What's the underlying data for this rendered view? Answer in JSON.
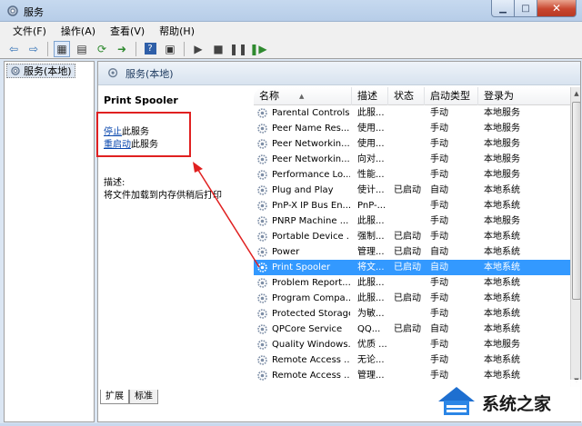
{
  "window": {
    "title": "服务"
  },
  "menu": [
    "文件(F)",
    "操作(A)",
    "查看(V)",
    "帮助(H)"
  ],
  "tree": {
    "root_label": "服务(本地)"
  },
  "pane_header": "服务(本地)",
  "detail": {
    "service_name": "Print Spooler",
    "stop_link": "停止",
    "stop_suffix": "此服务",
    "restart_link": "重启动",
    "restart_suffix": "此服务",
    "desc_label": "描述:",
    "desc_text": "将文件加载到内存供稍后打印"
  },
  "table": {
    "columns": [
      "名称",
      "描述",
      "状态",
      "启动类型",
      "登录为"
    ],
    "rows": [
      {
        "name": "Parental Controls",
        "desc": "此服...",
        "status": "",
        "startup": "手动",
        "logon": "本地服务"
      },
      {
        "name": "Peer Name Res...",
        "desc": "使用...",
        "status": "",
        "startup": "手动",
        "logon": "本地服务"
      },
      {
        "name": "Peer Networkin...",
        "desc": "使用...",
        "status": "",
        "startup": "手动",
        "logon": "本地服务"
      },
      {
        "name": "Peer Networkin...",
        "desc": "向对...",
        "status": "",
        "startup": "手动",
        "logon": "本地服务"
      },
      {
        "name": "Performance Lo...",
        "desc": "性能...",
        "status": "",
        "startup": "手动",
        "logon": "本地服务"
      },
      {
        "name": "Plug and Play",
        "desc": "使计...",
        "status": "已启动",
        "startup": "自动",
        "logon": "本地系统"
      },
      {
        "name": "PnP-X IP Bus En...",
        "desc": "PnP-...",
        "status": "",
        "startup": "手动",
        "logon": "本地系统"
      },
      {
        "name": "PNRP Machine ...",
        "desc": "此服...",
        "status": "",
        "startup": "手动",
        "logon": "本地服务"
      },
      {
        "name": "Portable Device ...",
        "desc": "强制...",
        "status": "已启动",
        "startup": "手动",
        "logon": "本地系统"
      },
      {
        "name": "Power",
        "desc": "管理...",
        "status": "已启动",
        "startup": "自动",
        "logon": "本地系统"
      },
      {
        "name": "Print Spooler",
        "desc": "将文...",
        "status": "已启动",
        "startup": "自动",
        "logon": "本地系统",
        "selected": true
      },
      {
        "name": "Problem Report...",
        "desc": "此服...",
        "status": "",
        "startup": "手动",
        "logon": "本地系统"
      },
      {
        "name": "Program Compa...",
        "desc": "此服...",
        "status": "已启动",
        "startup": "手动",
        "logon": "本地系统"
      },
      {
        "name": "Protected Storage",
        "desc": "为敏...",
        "status": "",
        "startup": "手动",
        "logon": "本地系统"
      },
      {
        "name": "QPCore Service",
        "desc": "QQ...",
        "status": "已启动",
        "startup": "自动",
        "logon": "本地系统"
      },
      {
        "name": "Quality Windows...",
        "desc": "优质 ...",
        "status": "",
        "startup": "手动",
        "logon": "本地服务"
      },
      {
        "name": "Remote Access ...",
        "desc": "无论...",
        "status": "",
        "startup": "手动",
        "logon": "本地系统"
      },
      {
        "name": "Remote Access ...",
        "desc": "管理...",
        "status": "",
        "startup": "手动",
        "logon": "本地系统"
      }
    ]
  },
  "tabs": [
    "扩展",
    "标准"
  ],
  "watermark": {
    "text": "系统之家"
  },
  "colors": {
    "selection": "#3399ff",
    "annotation": "#e02020"
  }
}
